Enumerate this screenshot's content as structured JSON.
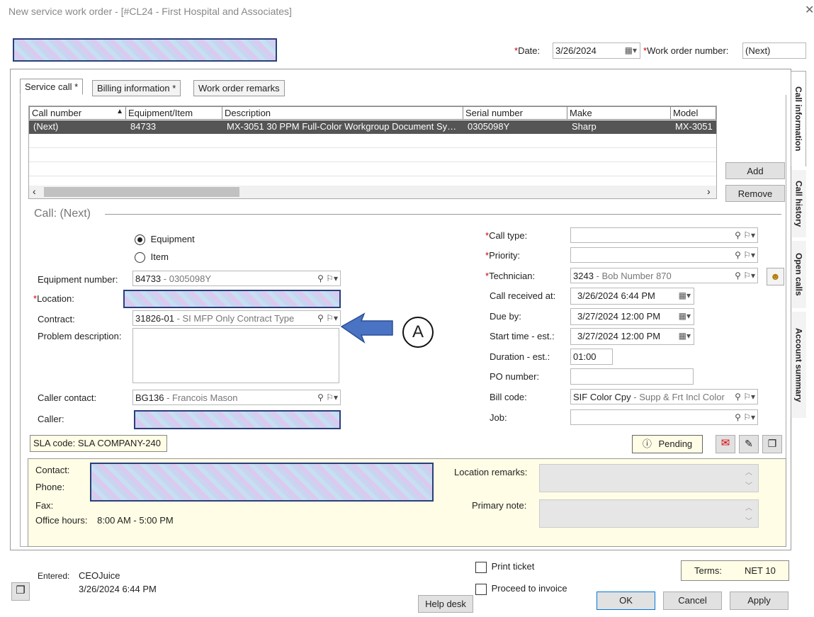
{
  "window": {
    "title": "New service work order - [#CL24 - First Hospital and Associates]"
  },
  "header": {
    "date_label": "Date:",
    "date_value": "3/26/2024",
    "work_order_label": "Work order number:",
    "work_order_value": "(Next)"
  },
  "tabs": [
    {
      "label": "Service call *"
    },
    {
      "label": "Billing information *"
    },
    {
      "label": "Work order remarks"
    }
  ],
  "side_tabs": [
    {
      "label": "Call information"
    },
    {
      "label": "Call history"
    },
    {
      "label": "Open calls"
    },
    {
      "label": "Account summary"
    }
  ],
  "grid": {
    "columns": [
      "Call number",
      "Equipment/Item",
      "Description",
      "Serial number",
      "Make",
      "Model"
    ],
    "rows": [
      [
        "(Next)",
        "84733",
        "MX-3051 30 PPM Full-Color Workgroup Document Sy…",
        "0305098Y",
        "Sharp",
        "MX-3051"
      ]
    ],
    "add_label": "Add",
    "remove_label": "Remove"
  },
  "call": {
    "section_title": "Call: (Next)",
    "radio_equipment": "Equipment",
    "radio_item": "Item",
    "equipment_number_label": "Equipment number:",
    "equipment_number_value": "84733",
    "equipment_number_sub": " - 0305098Y",
    "location_label": "Location:",
    "contract_label": "Contract:",
    "contract_value": "31826-01",
    "contract_sub": " - SI MFP Only Contract Type",
    "problem_label": "Problem description:",
    "caller_contact_label": "Caller contact:",
    "caller_contact_value": "BG136",
    "caller_contact_sub": " - Francois Mason",
    "caller_label": "Caller:",
    "sla_label": "SLA code: SLA COMPANY-240",
    "call_type_label": "Call type:",
    "priority_label": "Priority:",
    "technician_label": "Technician:",
    "technician_value": "3243",
    "technician_sub": " - Bob Number 870",
    "call_received_label": "Call received at:",
    "call_received_value": "3/26/2024  6:44 PM",
    "due_by_label": "Due by:",
    "due_by_value": "3/27/2024 12:00 PM",
    "start_time_label": "Start time - est.:",
    "start_time_value": "3/27/2024 12:00 PM",
    "duration_label": "Duration - est.:",
    "duration_value": "01:00",
    "po_label": "PO number:",
    "bill_code_label": "Bill code:",
    "bill_code_value": "SIF Color Cpy",
    "bill_code_sub": " - Supp & Frt Incl Color",
    "job_label": "Job:",
    "pending_label": "Pending"
  },
  "info_panel": {
    "contact_label": "Contact:",
    "phone_label": "Phone:",
    "fax_label": "Fax:",
    "office_hours_label": "Office hours:",
    "office_hours_value": "8:00 AM - 5:00 PM",
    "location_remarks_label": "Location remarks:",
    "primary_note_label": "Primary note:"
  },
  "annotation": {
    "marker": "A"
  },
  "footer": {
    "entered_label": "Entered:",
    "entered_by": "CEOJuice",
    "entered_at": "3/26/2024 6:44 PM",
    "print_ticket_label": "Print ticket",
    "proceed_invoice_label": "Proceed to invoice",
    "help_desk_label": "Help desk",
    "terms_label": "Terms:",
    "terms_value": "NET 10",
    "ok_label": "OK",
    "cancel_label": "Cancel",
    "apply_label": "Apply"
  }
}
